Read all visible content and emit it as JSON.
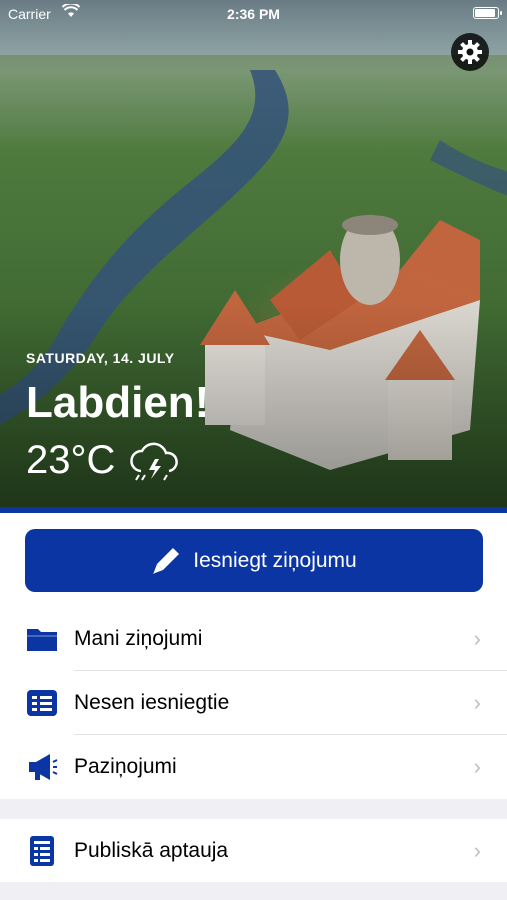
{
  "status_bar": {
    "carrier": "Carrier",
    "time": "2:36 PM"
  },
  "hero": {
    "date": "SATURDAY, 14. JULY",
    "greeting": "Labdien!",
    "temperature": "23°C",
    "weather_icon": "thunder-cloud-icon",
    "settings_icon": "gear-icon"
  },
  "primary_action": {
    "label": "Iesniegt ziņojumu",
    "icon": "pen-icon"
  },
  "menu": [
    {
      "label": "Mani ziņojumi",
      "icon": "folder-icon"
    },
    {
      "label": "Nesen iesniegtie",
      "icon": "list-icon"
    },
    {
      "label": "Paziņojumi",
      "icon": "megaphone-icon"
    },
    {
      "label": "Publiskā aptauja",
      "icon": "survey-icon"
    }
  ],
  "colors": {
    "accent": "#0a35a3",
    "background": "#efeff4",
    "chevron": "#bdbdc3"
  }
}
